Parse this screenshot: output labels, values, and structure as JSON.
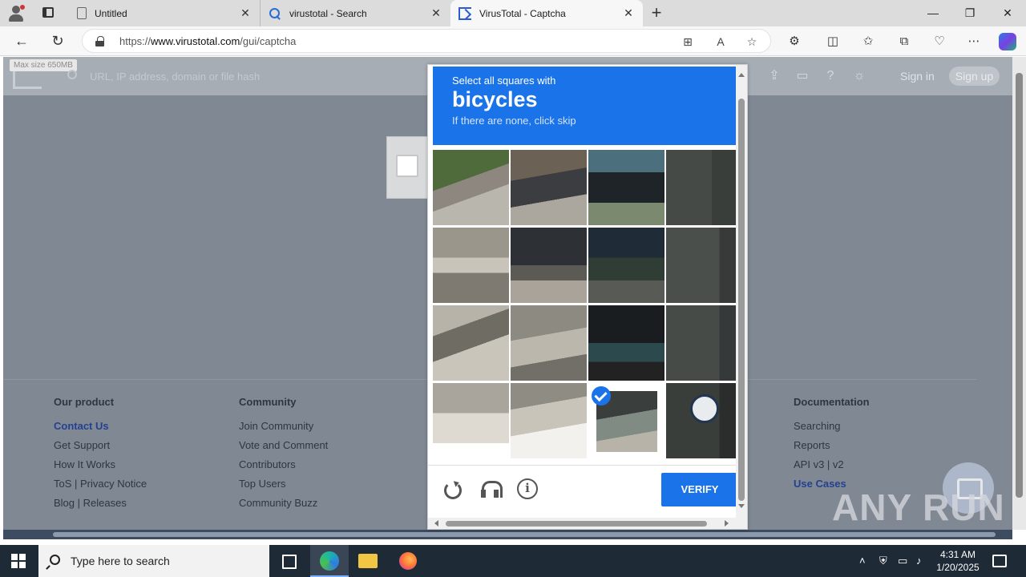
{
  "browser": {
    "tabs": [
      {
        "title": "Untitled",
        "close": "✕"
      },
      {
        "title": "virustotal - Search",
        "close": "✕"
      },
      {
        "title": "VirusTotal - Captcha",
        "close": "✕"
      }
    ],
    "new_tab": "+",
    "window_controls": {
      "minimize": "—",
      "maximize": "❐",
      "close": "✕"
    },
    "url_prefix": "https://",
    "url_domain": "www.virustotal.com",
    "url_path": "/gui/captcha"
  },
  "vt": {
    "max_size": "Max size 650MB",
    "search_placeholder": "URL, IP address, domain or file hash",
    "sign_in": "Sign in",
    "sign_up": "Sign up",
    "footer": {
      "our_product": {
        "title": "Our product",
        "links": [
          "Contact Us",
          "Get Support",
          "How It Works",
          "ToS | Privacy Notice",
          "Blog | Releases"
        ]
      },
      "community": {
        "title": "Community",
        "links": [
          "Join Community",
          "Vote and Comment",
          "Contributors",
          "Top Users",
          "Community Buzz"
        ]
      },
      "documentation": {
        "title": "Documentation",
        "links": [
          "Searching",
          "Reports",
          "API v3 | v2",
          "Use Cases"
        ]
      }
    },
    "watermark": "ANY RUN"
  },
  "captcha": {
    "select_text": "Select all squares with",
    "target": "bicycles",
    "skip_text": "If there are none, click skip",
    "selected_cells": [
      14
    ],
    "verify_label": "VERIFY",
    "info_glyph": "i"
  },
  "taskbar": {
    "search_text": "Type here to search",
    "time": "4:31 AM",
    "date": "1/20/2025"
  }
}
